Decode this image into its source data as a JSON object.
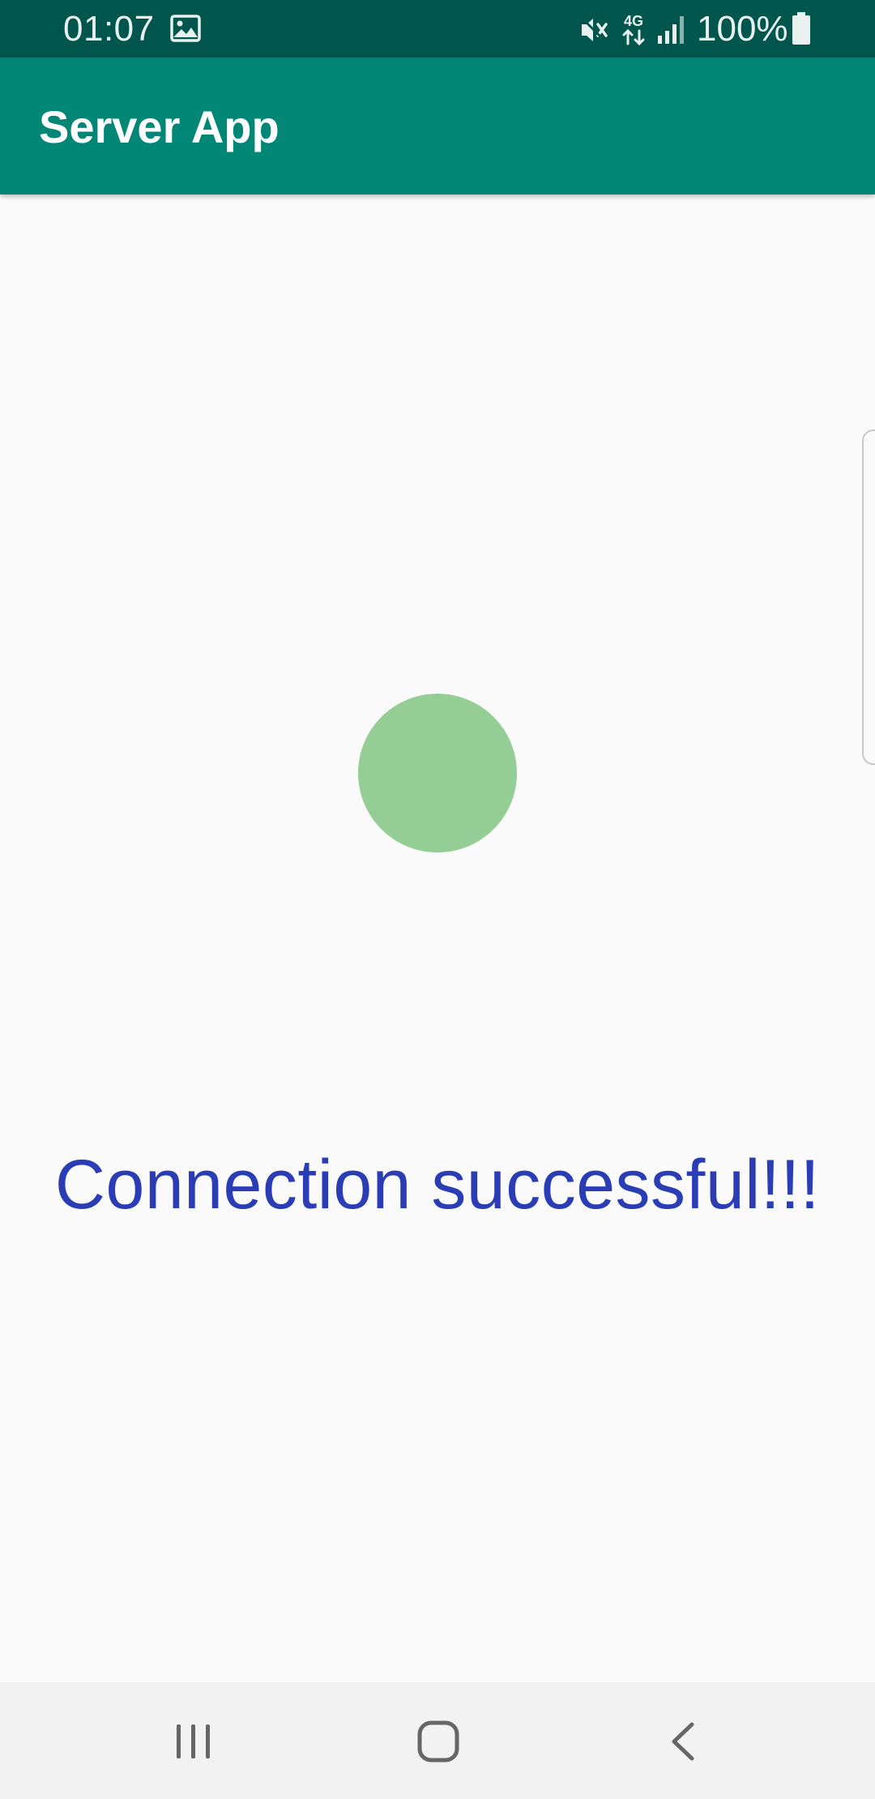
{
  "status_bar": {
    "time": "01:07",
    "battery_text": "100%",
    "network_label": "4G",
    "icons": [
      "gallery-icon",
      "mute-icon",
      "4g-data-icon",
      "signal-icon",
      "battery-icon"
    ],
    "background_color": "#00564d"
  },
  "app_bar": {
    "title": "Server App",
    "background_color": "#028676"
  },
  "main": {
    "status_indicator_color": "#95ce95",
    "message": "Connection successful!!!",
    "message_color": "#2a3db5"
  },
  "nav_bar": {
    "icons": [
      "recents-icon",
      "home-icon",
      "back-icon"
    ]
  }
}
